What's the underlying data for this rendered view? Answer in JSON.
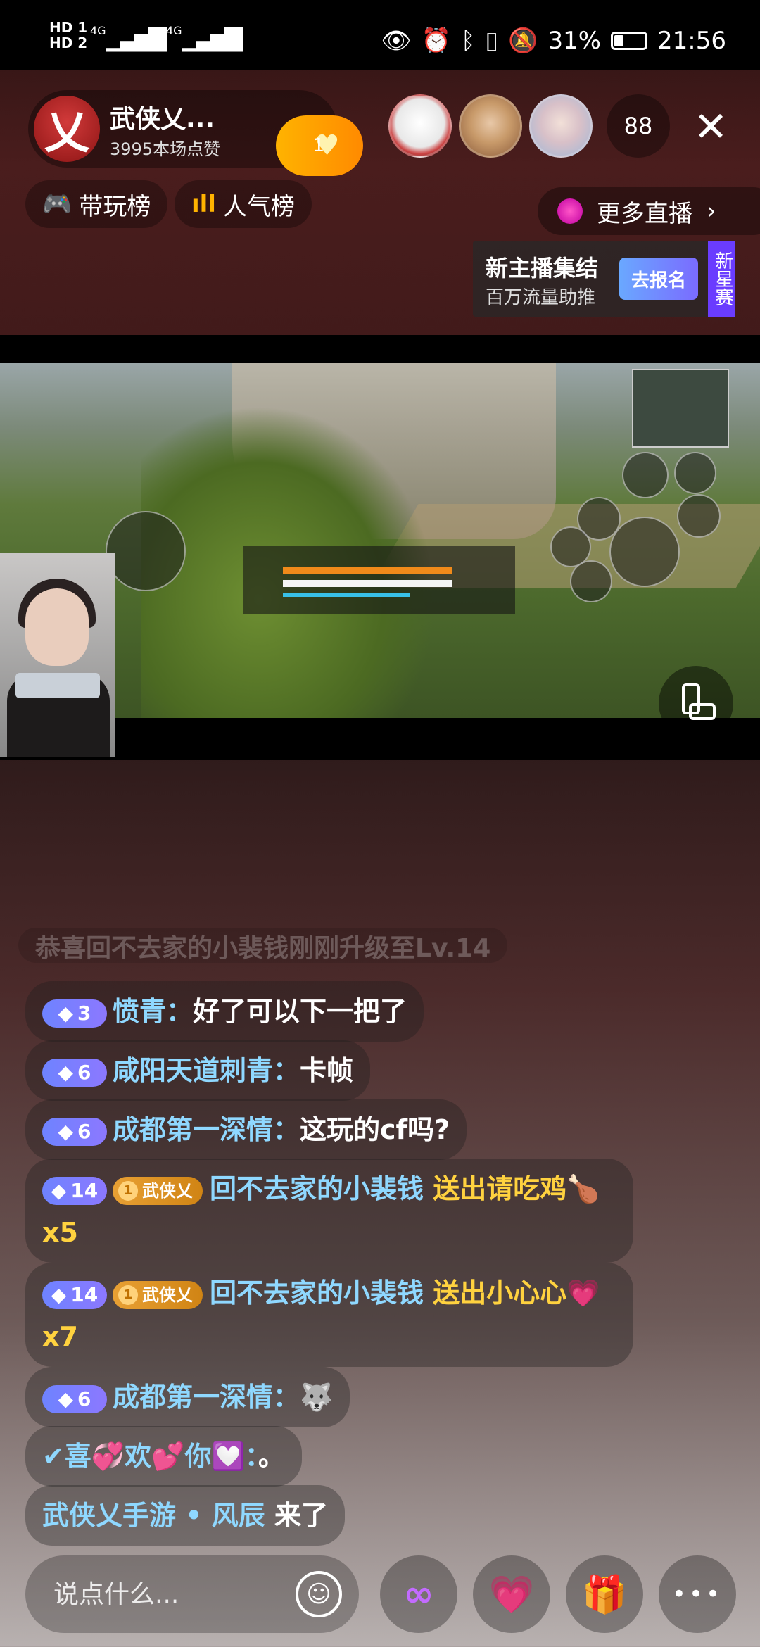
{
  "status_bar": {
    "sim1": "HD 1",
    "sim2": "HD 2",
    "net1": "4G",
    "net2": "4G",
    "battery_percent": "31%",
    "battery_level": 0.31,
    "time": "21:56",
    "icons": [
      "eye-icon",
      "alarm-icon",
      "bluetooth-icon",
      "vibrate-icon",
      "mute-icon"
    ]
  },
  "anchor": {
    "name": "武侠乂...",
    "logo_text": "乂",
    "likes": "3995本场点赞",
    "follow_badge": "1"
  },
  "viewers": {
    "count": "88",
    "close": "✕"
  },
  "chips": {
    "play_rank": "带玩榜",
    "popularity_rank": "人气榜",
    "more_live": "更多直播"
  },
  "promo": {
    "title": "新主播集结",
    "subtitle": "百万流量助推",
    "button": "去报名",
    "tag": "新星赛"
  },
  "chat": {
    "faded_line": "恭喜回不去家的小裴钱刚刚升级至Lv.14",
    "messages": [
      {
        "level": "3",
        "user": "愤青",
        "sep": "：",
        "text": "好了可以下一把了"
      },
      {
        "level": "6",
        "user": "咸阳天道刺青",
        "sep": "：",
        "text": "卡帧"
      },
      {
        "level": "6",
        "user": "成都第一深情",
        "sep": "：",
        "text": "这玩的cf吗?"
      },
      {
        "level": "14",
        "fan_badge": "武侠乂",
        "fan_level": "1",
        "user": "回不去家的小裴钱",
        "gift_prefix": "送出请吃",
        "gift_name": "鸡",
        "gift_icon": "🍗",
        "count": "x5"
      },
      {
        "level": "14",
        "fan_badge": "武侠乂",
        "fan_level": "1",
        "user": "回不去家的小裴钱",
        "gift_prefix": "送出小心",
        "gift_name": "心",
        "gift_icon": "💗",
        "count": "x7"
      },
      {
        "level": "6",
        "user": "成都第一深情",
        "sep": "：",
        "emoji": "🐺"
      },
      {
        "user": "✔喜💞欢💕你💟",
        "sep": "：",
        "text": "。"
      },
      {
        "user": "武侠乂手游 • 风辰",
        "text": "来了"
      }
    ]
  },
  "bottom": {
    "input_placeholder": "说点什么...",
    "emoji_icon": "☺",
    "link_icon": "∞",
    "heart_icon": "💗",
    "gift_icon": "🎁",
    "more_icon": "•••"
  },
  "colors": {
    "username": "#8fd8ff",
    "gift": "#ffd23f",
    "level_badge": "#7a7dff",
    "follow": "#ffa000"
  }
}
